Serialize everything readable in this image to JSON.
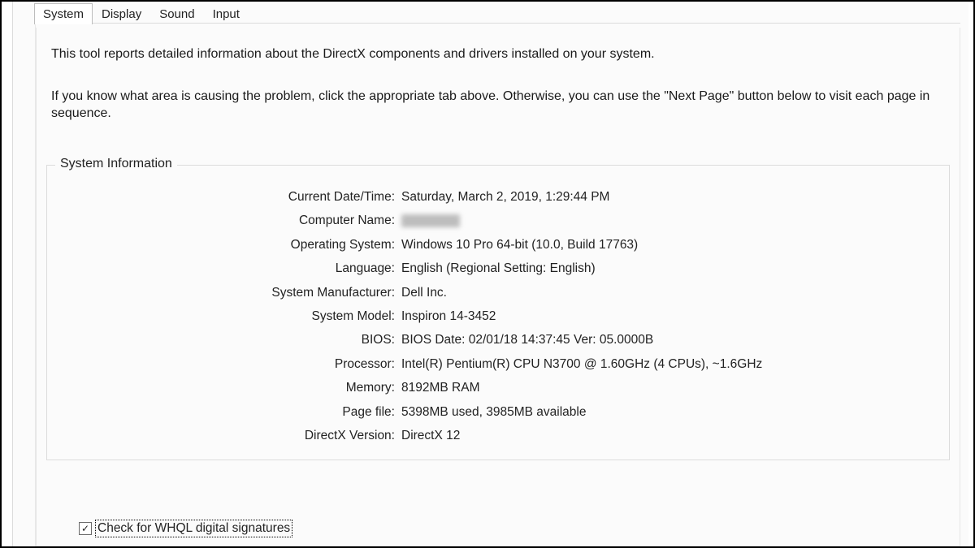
{
  "tabs": {
    "system": "System",
    "display": "Display",
    "sound": "Sound",
    "input": "Input"
  },
  "intro": {
    "p1": "This tool reports detailed information about the DirectX components and drivers installed on your system.",
    "p2": "If you know what area is causing the problem, click the appropriate tab above.  Otherwise, you can use the \"Next Page\" button below to visit each page in sequence."
  },
  "group": {
    "title": "System Information",
    "fields": {
      "current_datetime": {
        "label": "Current Date/Time:",
        "value": "Saturday, March 2, 2019, 1:29:44 PM"
      },
      "computer_name": {
        "label": "Computer Name:",
        "value": ""
      },
      "operating_system": {
        "label": "Operating System:",
        "value": "Windows 10 Pro 64-bit (10.0, Build 17763)"
      },
      "language": {
        "label": "Language:",
        "value": "English (Regional Setting: English)"
      },
      "system_manufacturer": {
        "label": "System Manufacturer:",
        "value": "Dell Inc."
      },
      "system_model": {
        "label": "System Model:",
        "value": "Inspiron 14-3452"
      },
      "bios": {
        "label": "BIOS:",
        "value": "BIOS Date: 02/01/18 14:37:45 Ver: 05.0000B"
      },
      "processor": {
        "label": "Processor:",
        "value": "Intel(R) Pentium(R) CPU  N3700  @ 1.60GHz (4 CPUs), ~1.6GHz"
      },
      "memory": {
        "label": "Memory:",
        "value": "8192MB RAM"
      },
      "page_file": {
        "label": "Page file:",
        "value": "5398MB used, 3985MB available"
      },
      "directx_version": {
        "label": "DirectX Version:",
        "value": "DirectX 12"
      }
    }
  },
  "checkbox": {
    "checked": true,
    "label": "Check for WHQL digital signatures"
  }
}
